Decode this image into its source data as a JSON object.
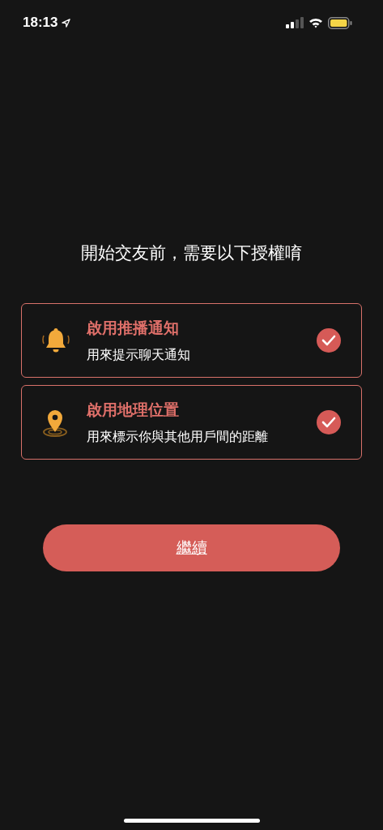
{
  "status_bar": {
    "time": "18:13"
  },
  "heading": "開始交友前，需要以下授權唷",
  "permissions": [
    {
      "kind": "bell",
      "title": "啟用推播通知",
      "description": "用來提示聊天通知",
      "checked": true
    },
    {
      "kind": "location",
      "title": "啟用地理位置",
      "description": "用來標示你與其他用戶間的距離",
      "checked": true
    }
  ],
  "continue_button": "繼續"
}
